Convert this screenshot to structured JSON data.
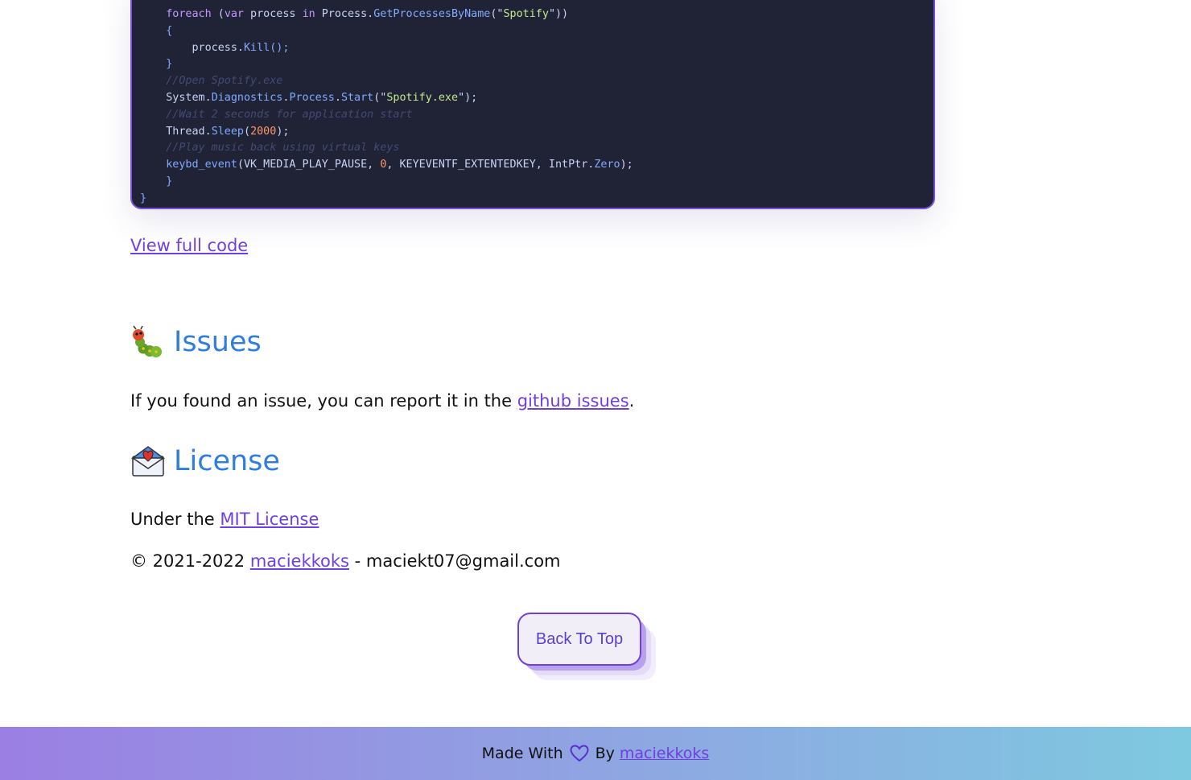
{
  "code": {
    "lines": [
      [
        {
          "t": "    ",
          "c": "pl"
        },
        {
          "t": "foreach",
          "c": "kw"
        },
        {
          "t": " (",
          "c": "pl"
        },
        {
          "t": "var",
          "c": "kw"
        },
        {
          "t": " process ",
          "c": "pl"
        },
        {
          "t": "in",
          "c": "kw"
        },
        {
          "t": " Process.",
          "c": "pl"
        },
        {
          "t": "GetProcessesByName",
          "c": "fn"
        },
        {
          "t": "(\"",
          "c": "pl"
        },
        {
          "t": "Spotify",
          "c": "str"
        },
        {
          "t": "\"))",
          "c": "pl"
        }
      ],
      [
        {
          "t": "    {",
          "c": "fn"
        }
      ],
      [
        {
          "t": "        process.",
          "c": "pl"
        },
        {
          "t": "Kill",
          "c": "fn"
        },
        {
          "t": "();",
          "c": "fn"
        }
      ],
      [
        {
          "t": "    }",
          "c": "fn"
        }
      ],
      [
        {
          "t": "    //Open Spotify.exe",
          "c": "cmt"
        }
      ],
      [
        {
          "t": "    System.",
          "c": "pl"
        },
        {
          "t": "Diagnostics",
          "c": "fn"
        },
        {
          "t": ".",
          "c": "pl"
        },
        {
          "t": "Process",
          "c": "fn"
        },
        {
          "t": ".",
          "c": "pl"
        },
        {
          "t": "Start",
          "c": "fn"
        },
        {
          "t": "(\"",
          "c": "pl"
        },
        {
          "t": "Spotify.exe",
          "c": "str"
        },
        {
          "t": "\");",
          "c": "pl"
        }
      ],
      [
        {
          "t": "    //Wait 2 seconds for application start",
          "c": "cmt"
        }
      ],
      [
        {
          "t": "    Thread.",
          "c": "pl"
        },
        {
          "t": "Sleep",
          "c": "fn"
        },
        {
          "t": "(",
          "c": "pl"
        },
        {
          "t": "2000",
          "c": "num"
        },
        {
          "t": ");",
          "c": "pl"
        }
      ],
      [
        {
          "t": "    //Play music back using virtual keys",
          "c": "cmt"
        }
      ],
      [
        {
          "t": "    ",
          "c": "pl"
        },
        {
          "t": "keybd_event",
          "c": "fn"
        },
        {
          "t": "(VK_MEDIA_PLAY_PAUSE, ",
          "c": "pl"
        },
        {
          "t": "0",
          "c": "num"
        },
        {
          "t": ", KEYEVENTF_EXTENTEDKEY, IntPtr.",
          "c": "pl"
        },
        {
          "t": "Zero",
          "c": "fn"
        },
        {
          "t": ");",
          "c": "pl"
        }
      ],
      [
        {
          "t": "    }",
          "c": "fn"
        }
      ],
      [
        {
          "t": "}",
          "c": "fn"
        }
      ]
    ]
  },
  "view_full_code": "View full code",
  "issues": {
    "title": "Issues",
    "icon": "caterpillar-emoji",
    "text_before": "If you found an issue, you can report it in the ",
    "link": "github issues",
    "text_after": "."
  },
  "license": {
    "title": "License",
    "icon": "envelope-heart-emoji",
    "text_before": "Under the ",
    "link": "MIT License"
  },
  "copyright": {
    "text_before": "© 2021-2022 ",
    "link": "maciekkoks",
    "text_after": " - maciekt07@gmail.com"
  },
  "back_to_top": "Back To Top",
  "footer": {
    "made_with": "Made With",
    "by": "By",
    "link": "maciekkoks"
  },
  "colors": {
    "heading": "#2f7de1",
    "link": "#6f3fe0",
    "code_bg": "#1f2335",
    "code_border": "#7a4fe0"
  }
}
